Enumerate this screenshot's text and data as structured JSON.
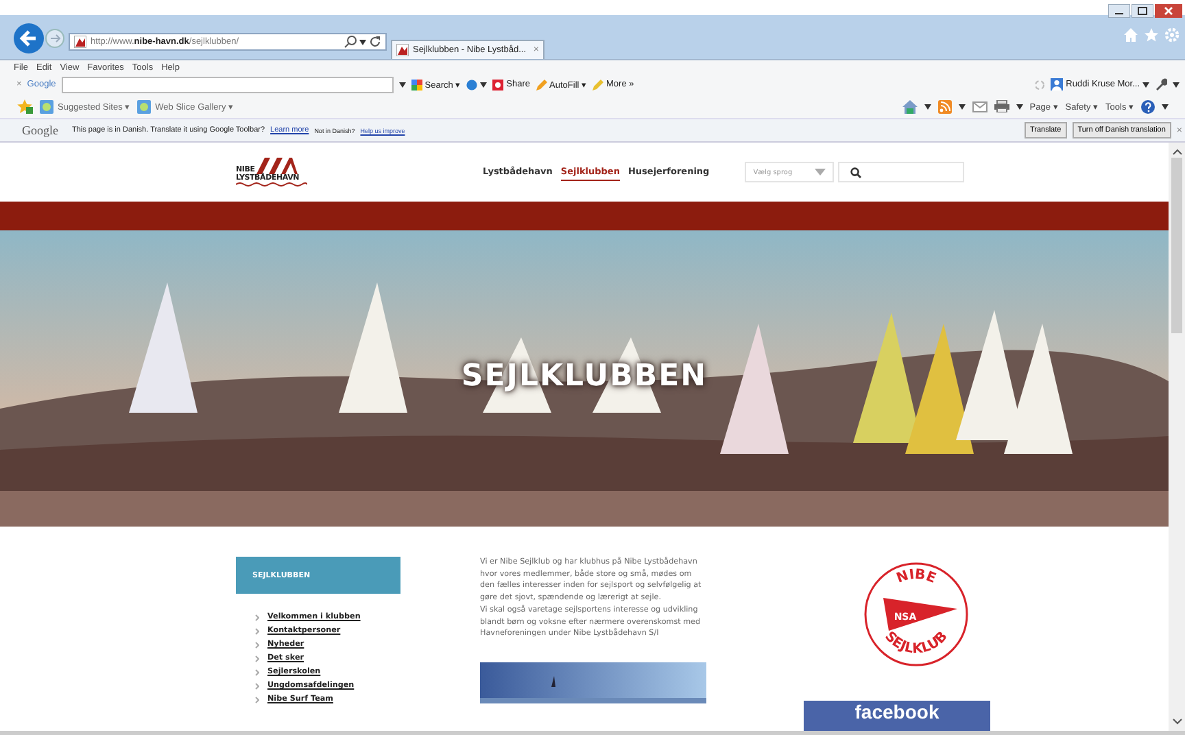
{
  "browser": {
    "address": {
      "prefix": "http://www.",
      "domain": "nibe-havn.dk",
      "path": "/sejlklubben/"
    },
    "tab": {
      "title": "Sejlklubben - Nibe Lystbåd...",
      "close": "×"
    },
    "menu": [
      "File",
      "Edit",
      "View",
      "Favorites",
      "Tools",
      "Help"
    ],
    "google_toolbar": {
      "close": "×",
      "label": "Google",
      "items": [
        {
          "label": "Search ▾"
        },
        {
          "label": "Share"
        },
        {
          "label": "AutoFill ▾"
        },
        {
          "label": "More »"
        }
      ],
      "user": "Ruddi Kruse Mor..."
    },
    "favorites": [
      {
        "label": "Suggested Sites ▾"
      },
      {
        "label": "Web Slice Gallery ▾"
      }
    ],
    "command_bar": [
      {
        "label": "Page ▾"
      },
      {
        "label": "Safety ▾"
      },
      {
        "label": "Tools ▾"
      }
    ],
    "translate_bar": {
      "logo": "Google",
      "message": "This page is in Danish.  Translate it using Google Toolbar?",
      "link": "Learn more",
      "note": "Not in Danish?",
      "link2": "Help us improve",
      "buttons": [
        "Translate",
        "Turn off Danish translation"
      ],
      "close": "×"
    }
  },
  "page": {
    "logo": {
      "top": "NIBE",
      "bottom": "LYSTBÅDEHAVN"
    },
    "nav": [
      {
        "label": "Lystbådehavn",
        "selected": false
      },
      {
        "label": "Sejlklubben",
        "selected": true
      },
      {
        "label": "Husejerforening",
        "selected": false
      }
    ],
    "language_select": {
      "value": "Vælg sprog"
    },
    "hero": {
      "title": "SEJLKLUBBEN"
    },
    "sidebar": {
      "heading": "SEJLKLUBBEN",
      "items": [
        "Velkommen i klubben",
        "Kontaktpersoner",
        "Nyheder",
        "Det sker",
        "Sejlerskolen",
        "Ungdomsafdelingen",
        "Nibe Surf Team"
      ]
    },
    "intro": [
      "Vi er Nibe Sejlklub og har klubhus på Nibe Lystbådehavn hvor vores medlemmer, både store og små, mødes om den fælles interesser inden for sejlsport og selvfølgelig at gøre det sjovt, spændende og lærerigt at sejle.",
      "Vi skal også varetage sejlsportens interesse og udvikling blandt børn og voksne efter nærmere overenskomst med Havneforeningen under Nibe Lystbådehavn S/I"
    ],
    "club_badge": {
      "top": "NIBE",
      "flag": "NSA",
      "bottom": "SEJLKLUB"
    },
    "facebook": "facebook"
  }
}
